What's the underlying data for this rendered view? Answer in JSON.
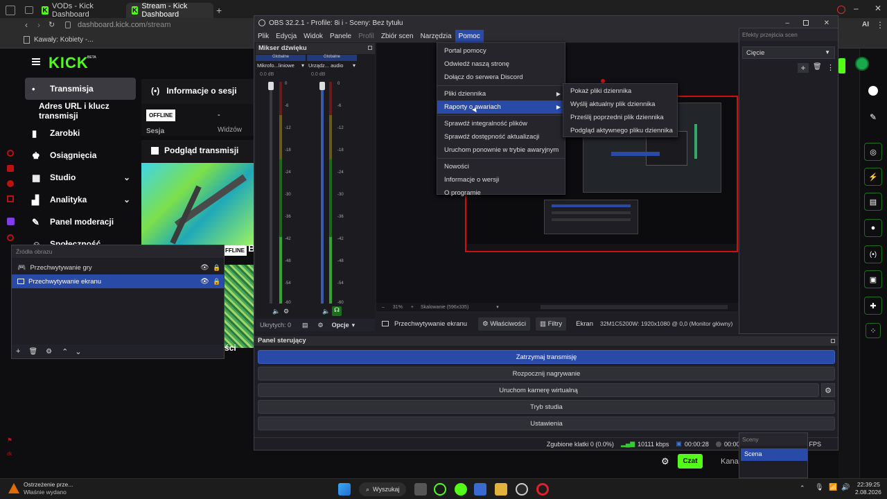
{
  "browser": {
    "tabs": [
      {
        "label": "VODs - Kick Dashboard",
        "active": false
      },
      {
        "label": "Stream - Kick Dashboard",
        "active": true
      }
    ],
    "url_domain": "dashboard.kick.com",
    "url_path": "/stream",
    "bookmark": "Kawały: Kobiety -..."
  },
  "kick": {
    "logo": "KICK",
    "logo_sup": "BETA",
    "nav": [
      "Transmisja",
      "Adres URL i klucz transmisji",
      "Zarobki",
      "Osiągnięcia",
      "Studio",
      "Analityka",
      "Panel moderacji",
      "Społeczność"
    ],
    "session_title": "Informacje o sesji",
    "offline_badge": "OFFLINE",
    "session_label": "Sesja",
    "viewers_label": "Widzów",
    "viewers_value": "-",
    "preview_title": "Podgląd transmisji",
    "offline_badge2": "FFLINE",
    "partial_b": "B",
    "partial_si": "ści",
    "chat_button": "Czat",
    "partial_kana": "Kana"
  },
  "obs": {
    "title": "OBS 32.2.1 - Profile: 8i i - Sceny: Bez tytułu",
    "menu": [
      "Plik",
      "Edycja",
      "Widok",
      "Panele",
      "Profil",
      "Zbiór scen",
      "Narzędzia",
      "Pomoc"
    ],
    "mixer_title": "Mikser dźwięku",
    "channels": [
      {
        "group": "Globalne",
        "name": "Mikrofo...liniowe",
        "db": "0.0 dB"
      },
      {
        "group": "Globalne",
        "name": "Urządz... audio",
        "db": "0.0 dB"
      }
    ],
    "meter_ticks": [
      "0",
      "-6",
      "-12",
      "-18",
      "-24",
      "-30",
      "-36",
      "-42",
      "-48",
      "-54",
      "-60"
    ],
    "hidden_count": "Ukrytych: 0",
    "options": "Opcje",
    "zoom": "31%",
    "scaling": "Skalowanie (596x335)",
    "source_name": "Przechwytywanie ekranu",
    "properties": "Właściwości",
    "filters": "Filtry",
    "screen_label": "Ekran",
    "screen_value": "32M1C5200W: 1920x1080 @ 0,0 (Monitor główny)",
    "help_menu": [
      "Portal pomocy",
      "Odwiedź naszą stronę",
      "Dołącz do serwera Discord",
      "Pliki dziennika",
      "Raporty o awariach",
      "Sprawdź integralność plików",
      "Sprawdź dostępność aktualizacji",
      "Uruchom ponownie w trybie awaryjnym",
      "Nowości",
      "Informacje o wersji",
      "O programie"
    ],
    "submenu": [
      "Pokaż pliki dziennika",
      "Wyślij aktualny plik dziennika",
      "Prześlij poprzedni plik dziennika",
      "Podgląd aktywnego pliku dziennika"
    ],
    "control_title": "Panel sterujący",
    "controls": [
      "Zatrzymaj transmisję",
      "Rozpocznij nagrywanie",
      "Uruchom kamerę wirtualną",
      "Tryb studia",
      "Ustawienia"
    ],
    "status": {
      "dropped": "Zgubione klatki 0 (0.0%)",
      "kbps": "10111 kbps",
      "stream_time": "00:00:28",
      "rec_time": "00:00:00",
      "fps": "0 FPS"
    }
  },
  "transitions": {
    "title": "Efekty przejścia scen",
    "selected": "Cięcie"
  },
  "scenes": {
    "title": "Sceny",
    "item": "Scena"
  },
  "sources": {
    "title": "Źródła obrazu",
    "items": [
      "Przechwytywanie gry",
      "Przechwytywanie ekranu"
    ]
  },
  "taskbar": {
    "notif_title": "Ostrzeżenie prze...",
    "notif_sub": "Właśnie wydano",
    "search": "Wyszukaj",
    "time": "22:39:25",
    "date": "2.08.2026"
  }
}
